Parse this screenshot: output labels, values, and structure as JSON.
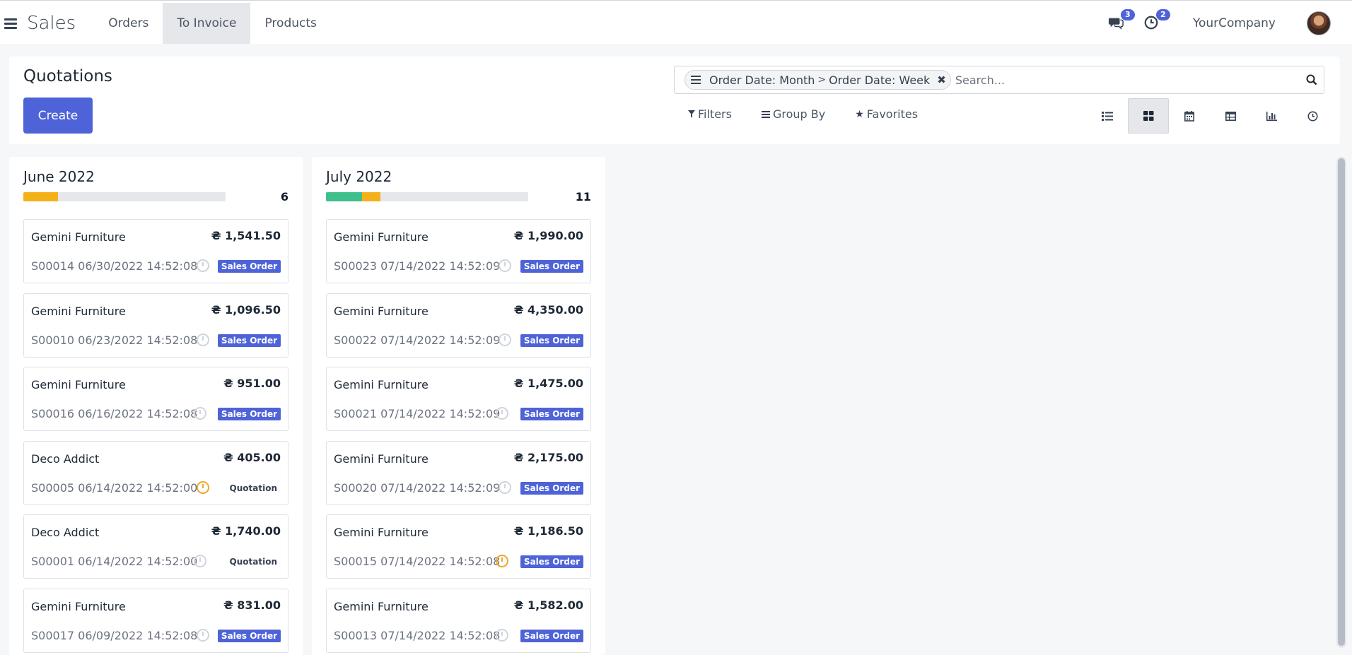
{
  "navbar": {
    "app_title": "Sales",
    "menu": [
      "Orders",
      "To Invoice",
      "Products"
    ],
    "active_menu": "To Invoice",
    "messages_count": "3",
    "activities_count": "2",
    "company": "YourCompany"
  },
  "control_panel": {
    "title": "Quotations",
    "create_label": "Create",
    "facet_first": "Order Date: Month",
    "facet_sep": ">",
    "facet_second": "Order Date: Week",
    "search_placeholder": "Search...",
    "filters_label": "Filters",
    "group_by_label": "Group By",
    "favorites_label": "Favorites",
    "views": [
      "list-view-icon",
      "kanban-view-icon",
      "calendar-view-icon",
      "pivot-view-icon",
      "graph-view-icon",
      "activity-view-icon"
    ],
    "active_view": "kanban-view-icon"
  },
  "colors": {
    "accent": "#4f63d8",
    "progress_green": "#3fbf8c",
    "progress_orange": "#f5b11a",
    "activity_overdue": "#f0a62b"
  },
  "columns": [
    {
      "title": "June 2022",
      "count": "6",
      "progress": {
        "green": 0,
        "orange": 0.17
      },
      "cards": [
        {
          "partner": "Gemini Furniture",
          "amount": "₴ 1,541.50",
          "ref": "S00014 06/30/2022 14:52:08",
          "status": "Sales Order",
          "activity": "none"
        },
        {
          "partner": "Gemini Furniture",
          "amount": "₴ 1,096.50",
          "ref": "S00010 06/23/2022 14:52:08",
          "status": "Sales Order",
          "activity": "none"
        },
        {
          "partner": "Gemini Furniture",
          "amount": "₴ 951.00",
          "ref": "S00016 06/16/2022 14:52:08",
          "status": "Sales Order",
          "activity": "none"
        },
        {
          "partner": "Deco Addict",
          "amount": "₴ 405.00",
          "ref": "S00005 06/14/2022 14:52:00",
          "status": "Quotation",
          "activity": "overdue"
        },
        {
          "partner": "Deco Addict",
          "amount": "₴ 1,740.00",
          "ref": "S00001 06/14/2022 14:52:00",
          "status": "Quotation",
          "activity": "none"
        },
        {
          "partner": "Gemini Furniture",
          "amount": "₴ 831.00",
          "ref": "S00017 06/09/2022 14:52:08",
          "status": "Sales Order",
          "activity": "none"
        }
      ]
    },
    {
      "title": "July 2022",
      "count": "11",
      "progress": {
        "green": 0.18,
        "orange": 0.09
      },
      "cards": [
        {
          "partner": "Gemini Furniture",
          "amount": "₴ 1,990.00",
          "ref": "S00023 07/14/2022 14:52:09",
          "status": "Sales Order",
          "activity": "none"
        },
        {
          "partner": "Gemini Furniture",
          "amount": "₴ 4,350.00",
          "ref": "S00022 07/14/2022 14:52:09",
          "status": "Sales Order",
          "activity": "none"
        },
        {
          "partner": "Gemini Furniture",
          "amount": "₴ 1,475.00",
          "ref": "S00021 07/14/2022 14:52:09",
          "status": "Sales Order",
          "activity": "none"
        },
        {
          "partner": "Gemini Furniture",
          "amount": "₴ 2,175.00",
          "ref": "S00020 07/14/2022 14:52:09",
          "status": "Sales Order",
          "activity": "none"
        },
        {
          "partner": "Gemini Furniture",
          "amount": "₴ 1,186.50",
          "ref": "S00015 07/14/2022 14:52:08",
          "status": "Sales Order",
          "activity": "overdue"
        },
        {
          "partner": "Gemini Furniture",
          "amount": "₴ 1,582.00",
          "ref": "S00013 07/14/2022 14:52:08",
          "status": "Sales Order",
          "activity": "none"
        }
      ]
    }
  ]
}
